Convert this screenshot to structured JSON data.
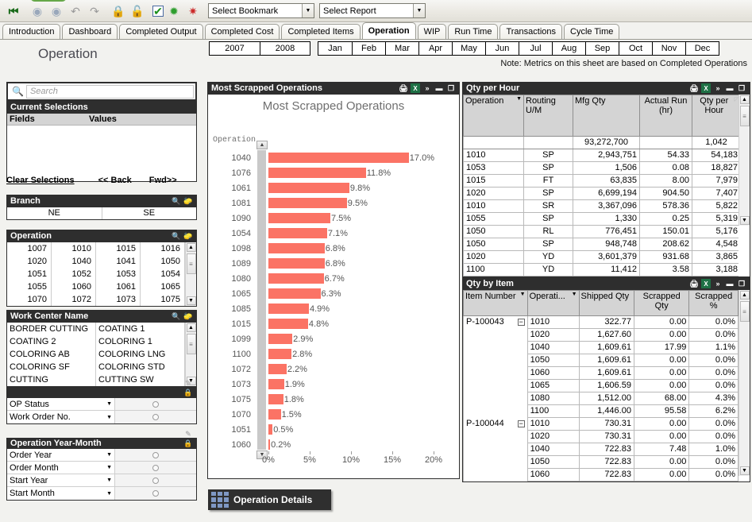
{
  "toolbar": {
    "icons": [
      {
        "name": "go-to-start-icon",
        "glyph": "⏮"
      },
      {
        "name": "back-icon",
        "glyph": "←"
      },
      {
        "name": "forward-icon",
        "glyph": "→"
      },
      {
        "name": "undo-icon",
        "glyph": "↶"
      },
      {
        "name": "redo-icon",
        "glyph": "↷"
      },
      {
        "name": "lock-icon",
        "glyph": "🔒"
      },
      {
        "name": "unlock-icon",
        "glyph": "🔓"
      },
      {
        "name": "check-icon",
        "glyph": "✔"
      },
      {
        "name": "clear-selection-icon",
        "glyph": "★"
      },
      {
        "name": "clear-all-icon",
        "glyph": "✖"
      }
    ],
    "bookmark_select": "Select Bookmark",
    "report_select": "Select Report"
  },
  "tabs": [
    {
      "label": "Introduction",
      "active": false
    },
    {
      "label": "Dashboard",
      "active": false
    },
    {
      "label": "Completed Output",
      "active": false
    },
    {
      "label": "Completed Cost",
      "active": false
    },
    {
      "label": "Completed Items",
      "active": false
    },
    {
      "label": "Operation",
      "active": true
    },
    {
      "label": "WIP",
      "active": false
    },
    {
      "label": "Run Time",
      "active": false
    },
    {
      "label": "Transactions",
      "active": false
    },
    {
      "label": "Cycle Time",
      "active": false
    }
  ],
  "page": {
    "title": "Operation",
    "years": [
      "2007",
      "2008"
    ],
    "months": [
      "Jan",
      "Feb",
      "Mar",
      "Apr",
      "May",
      "Jun",
      "Jul",
      "Aug",
      "Sep",
      "Oct",
      "Nov",
      "Dec"
    ],
    "note": "Note: Metrics on this sheet are based on Completed Operations"
  },
  "search": {
    "placeholder": "Search",
    "value": ""
  },
  "current_selections": {
    "title": "Current Selections",
    "columns": [
      "Fields",
      "Values"
    ],
    "rows": []
  },
  "selection_buttons": {
    "clear": "Clear Selections",
    "back": "<< Back",
    "forward": "Fwd>>"
  },
  "branch": {
    "title": "Branch",
    "values": [
      "NE",
      "SE"
    ]
  },
  "operation_list": {
    "title": "Operation",
    "values": [
      "1007",
      "1010",
      "1015",
      "1016",
      "1020",
      "1040",
      "1041",
      "1050",
      "1051",
      "1052",
      "1053",
      "1054",
      "1055",
      "1060",
      "1061",
      "1065",
      "1070",
      "1072",
      "1073",
      "1075"
    ]
  },
  "work_center": {
    "title": "Work Center Name",
    "values": [
      "BORDER CUTTING",
      "COATING 1",
      "COATING 2",
      "COLORING 1",
      "COLORING AB",
      "COLORING LNG",
      "COLORING SF",
      "COLORING STD",
      "CUTTING",
      "CUTTING SW"
    ]
  },
  "multibox_status": {
    "title": "",
    "rows": [
      {
        "label": "OP Status",
        "value": ""
      },
      {
        "label": "Work Order No.",
        "value": ""
      }
    ]
  },
  "multibox_yearmonth": {
    "title": "Operation Year-Month",
    "rows": [
      {
        "label": "Order Year",
        "value": ""
      },
      {
        "label": "Order Month",
        "value": ""
      },
      {
        "label": "Start Year",
        "value": ""
      },
      {
        "label": "Start Month",
        "value": ""
      }
    ]
  },
  "chart_panel": {
    "caption": "Most Scrapped Operations"
  },
  "chart_data": {
    "type": "bar",
    "orientation": "horizontal",
    "title": "Most Scrapped Operations",
    "xlabel": "",
    "ylabel": "Operation",
    "xlim": [
      0,
      22.5
    ],
    "grid": false,
    "legend": false,
    "bar_color": "#fb7365",
    "tick_labels": [
      "0%",
      "5%",
      "10%",
      "15%",
      "20%"
    ],
    "ticks": [
      0,
      5,
      10,
      15,
      20
    ],
    "categories": [
      "1040",
      "1076",
      "1061",
      "1081",
      "1090",
      "1054",
      "1098",
      "1089",
      "1080",
      "1065",
      "1085",
      "1015",
      "1099",
      "1100",
      "1072",
      "1073",
      "1075",
      "1070",
      "1051",
      "1060"
    ],
    "values": [
      17.0,
      11.8,
      9.8,
      9.5,
      7.5,
      7.1,
      6.8,
      6.8,
      6.7,
      6.3,
      4.9,
      4.8,
      2.9,
      2.8,
      2.2,
      1.9,
      1.8,
      1.5,
      0.5,
      0.2
    ],
    "data_labels": [
      "17.0%",
      "11.8%",
      "9.8%",
      "9.5%",
      "7.5%",
      "7.1%",
      "6.8%",
      "6.8%",
      "6.7%",
      "6.3%",
      "4.9%",
      "4.8%",
      "2.9%",
      "2.8%",
      "2.2%",
      "1.9%",
      "1.8%",
      "1.5%",
      "0.5%",
      "0.2%"
    ]
  },
  "qty_per_hour": {
    "caption": "Qty per Hour",
    "columns": [
      "Operation",
      "Routing U/M",
      "Mfg Qty",
      "Actual Run (hr)",
      "Qty per Hour"
    ],
    "total_row": {
      "operation": "",
      "uom": "",
      "mfg_qty": "93,272,700",
      "actual_run": "",
      "qty_per_hour": "1,042"
    },
    "rows": [
      {
        "operation": "1010",
        "uom": "SP",
        "mfg_qty": "2,943,751",
        "actual_run": "54.33",
        "qty_per_hour": "54,183"
      },
      {
        "operation": "1053",
        "uom": "SP",
        "mfg_qty": "1,506",
        "actual_run": "0.08",
        "qty_per_hour": "18,827"
      },
      {
        "operation": "1015",
        "uom": "FT",
        "mfg_qty": "63,835",
        "actual_run": "8.00",
        "qty_per_hour": "7,979"
      },
      {
        "operation": "1020",
        "uom": "SP",
        "mfg_qty": "6,699,194",
        "actual_run": "904.50",
        "qty_per_hour": "7,407"
      },
      {
        "operation": "1010",
        "uom": "SR",
        "mfg_qty": "3,367,096",
        "actual_run": "578.36",
        "qty_per_hour": "5,822"
      },
      {
        "operation": "1055",
        "uom": "SP",
        "mfg_qty": "1,330",
        "actual_run": "0.25",
        "qty_per_hour": "5,319"
      },
      {
        "operation": "1050",
        "uom": "RL",
        "mfg_qty": "776,451",
        "actual_run": "150.01",
        "qty_per_hour": "5,176"
      },
      {
        "operation": "1050",
        "uom": "SP",
        "mfg_qty": "948,748",
        "actual_run": "208.62",
        "qty_per_hour": "4,548"
      },
      {
        "operation": "1020",
        "uom": "YD",
        "mfg_qty": "3,601,379",
        "actual_run": "931.68",
        "qty_per_hour": "3,865"
      },
      {
        "operation": "1100",
        "uom": "YD",
        "mfg_qty": "11,412",
        "actual_run": "3.58",
        "qty_per_hour": "3,188"
      }
    ]
  },
  "qty_by_item": {
    "caption": "Qty by Item",
    "columns": [
      "Item Number",
      "Operati...",
      "Shipped Qty",
      "Scrapped Qty",
      "Scrapped %"
    ],
    "rows": [
      {
        "item": "P-100043",
        "expand": true,
        "operation": "1010",
        "shipped": "322.77",
        "scrapped": "0.00",
        "pct": "0.0%"
      },
      {
        "item": "",
        "expand": false,
        "operation": "1020",
        "shipped": "1,627.60",
        "scrapped": "0.00",
        "pct": "0.0%"
      },
      {
        "item": "",
        "expand": false,
        "operation": "1040",
        "shipped": "1,609.61",
        "scrapped": "17.99",
        "pct": "1.1%"
      },
      {
        "item": "",
        "expand": false,
        "operation": "1050",
        "shipped": "1,609.61",
        "scrapped": "0.00",
        "pct": "0.0%"
      },
      {
        "item": "",
        "expand": false,
        "operation": "1060",
        "shipped": "1,609.61",
        "scrapped": "0.00",
        "pct": "0.0%"
      },
      {
        "item": "",
        "expand": false,
        "operation": "1065",
        "shipped": "1,606.59",
        "scrapped": "0.00",
        "pct": "0.0%"
      },
      {
        "item": "",
        "expand": false,
        "operation": "1080",
        "shipped": "1,512.00",
        "scrapped": "68.00",
        "pct": "4.3%"
      },
      {
        "item": "",
        "expand": false,
        "operation": "1100",
        "shipped": "1,446.00",
        "scrapped": "95.58",
        "pct": "6.2%"
      },
      {
        "item": "P-100044",
        "expand": true,
        "operation": "1010",
        "shipped": "730.31",
        "scrapped": "0.00",
        "pct": "0.0%"
      },
      {
        "item": "",
        "expand": false,
        "operation": "1020",
        "shipped": "730.31",
        "scrapped": "0.00",
        "pct": "0.0%"
      },
      {
        "item": "",
        "expand": false,
        "operation": "1040",
        "shipped": "722.83",
        "scrapped": "7.48",
        "pct": "1.0%"
      },
      {
        "item": "",
        "expand": false,
        "operation": "1050",
        "shipped": "722.83",
        "scrapped": "0.00",
        "pct": "0.0%"
      },
      {
        "item": "",
        "expand": false,
        "operation": "1060",
        "shipped": "722.83",
        "scrapped": "0.00",
        "pct": "0.0%"
      }
    ]
  },
  "bottom_button": {
    "label": "Operation Details"
  }
}
